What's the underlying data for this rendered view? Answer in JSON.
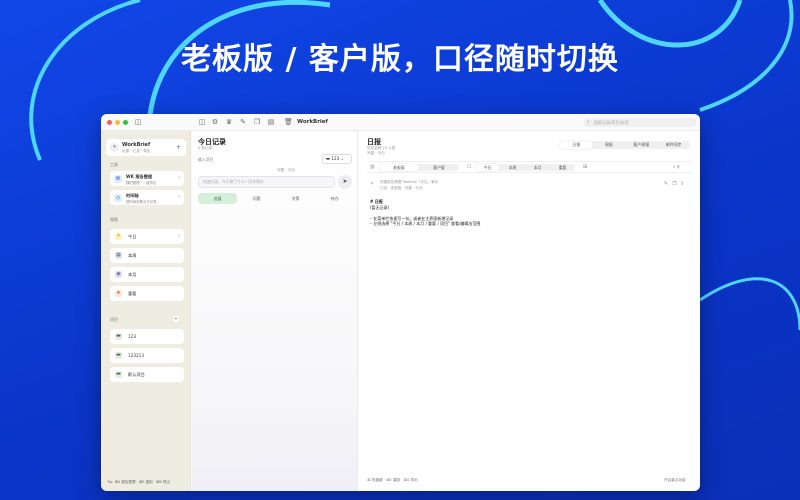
{
  "headline": "老板版 / 客户版，口径随时切换",
  "colors": {
    "background": "#0b3fd6",
    "accent_cyan": "#4fd6ff",
    "window": "#fbfbfc",
    "sidebar": "#efece1",
    "active_green": "#d6eedc"
  },
  "titlebar": {
    "app_name": "WorkBrief",
    "search_placeholder": "搜索记录/项目/标签",
    "icons": [
      "sidebar-toggle-icon",
      "gear-icon",
      "crown-icon",
      "pencil-icon",
      "copy-icon",
      "document-icon",
      "trash-icon"
    ]
  },
  "sidebar": {
    "brand_title": "WorkBrief",
    "brand_sub": "记录 · 汇总 · 导出",
    "plus": "+",
    "section_tools": "工具",
    "tools": [
      {
        "title": "WK 报告整理",
        "desc": "随时整理 · 一键导出",
        "icon": "⌘"
      },
      {
        "title": "时间轴",
        "desc": "按时间查看今日记录",
        "icon": "◷"
      }
    ],
    "section_views": "视图",
    "views": [
      {
        "label": "今日",
        "icon": "☀"
      },
      {
        "label": "本周",
        "icon": "▦"
      },
      {
        "label": "本月",
        "icon": "◉"
      },
      {
        "label": "重要",
        "icon": "★"
      }
    ],
    "section_projects": "项目",
    "project_add": "+",
    "projects": [
      "123",
      "123213",
      "默认项目"
    ],
    "tip": "Tip: ⌘K 报告整理 · ⌘E 重制 · ⌘B 导出"
  },
  "middle": {
    "title": "今日记录",
    "subtitle": "0 条记录",
    "field_label": "输入项目",
    "project_selected": "123",
    "hint": "完善 · 今日",
    "input_placeholder": "快速记录，今天做了什么？回车保存",
    "send_icon": "➤",
    "categories": [
      "进展",
      "问题",
      "决策",
      "待办"
    ],
    "active_category": 0
  },
  "right": {
    "title": "日报",
    "sub1": "项目名称 | 0 人数",
    "sub2": "完善 · 今日",
    "top_tabs": [
      "日报",
      "周报",
      "客户周报",
      "邮件同步"
    ],
    "top_active": 0,
    "mode_tabs": [
      "老板版",
      "客户版"
    ],
    "mode_active": 0,
    "range_tabs": [
      "今日",
      "本周",
      "本月",
      "重要"
    ],
    "range_active": 0,
    "count_label": "0 条",
    "summary_line1": "完善报告摘要 WeBrief「今日」事件",
    "summary_line2": "口径 · 老板版 · 完善 · 今日",
    "content": [
      "# 日报",
      "(暂无记录)",
      "",
      "– 在菜单栏快速写一句，或者在主界面新增记录",
      "– 左侧选择 \"今日 / 本周 / 本月 / 重要 / 项目\" 查看/编辑出范围"
    ],
    "footer_left": "⌘ 快捷键 · ⌘E 重制 · ⌘S 导出",
    "footer_right": "开启重点功能"
  }
}
